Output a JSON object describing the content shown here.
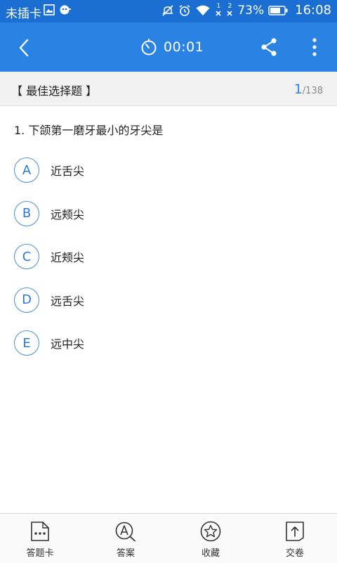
{
  "status_bar": {
    "carrier": "未插卡",
    "sim1_label": "1",
    "sim2_label": "2",
    "battery": "73%",
    "time": "16:08"
  },
  "toolbar": {
    "timer": "00:01",
    "icons": [
      "back-arrow",
      "stopwatch",
      "share",
      "more-vertical"
    ]
  },
  "section": {
    "title": "【 最佳选择题 】",
    "current": "1",
    "total": "/138"
  },
  "question": {
    "text": "1. 下颌第一磨牙最小的牙尖是",
    "options": [
      {
        "key": "A",
        "text": "近舌尖"
      },
      {
        "key": "B",
        "text": "远颊尖"
      },
      {
        "key": "C",
        "text": "近颊尖"
      },
      {
        "key": "D",
        "text": "远舌尖"
      },
      {
        "key": "E",
        "text": "远中尖"
      }
    ]
  },
  "bottom_bar": {
    "items": [
      {
        "label": "答题卡",
        "icon": "answer-sheet"
      },
      {
        "label": "答案",
        "icon": "answer-search"
      },
      {
        "label": "收藏",
        "icon": "star"
      },
      {
        "label": "交卷",
        "icon": "submit"
      }
    ]
  },
  "colors": {
    "status_bar": "#1c6fd2",
    "toolbar": "#2a83e2",
    "accent": "#2a83e2"
  }
}
